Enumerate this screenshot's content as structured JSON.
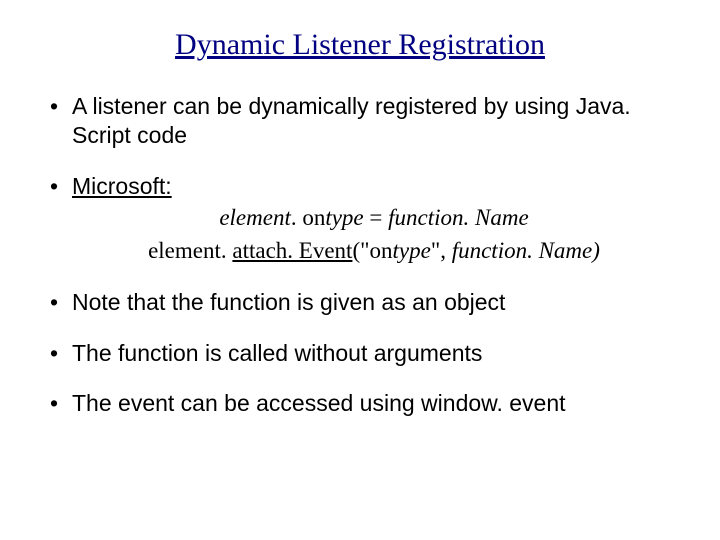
{
  "title": "Dynamic Listener Registration",
  "bullets": {
    "b1": "A listener can be dynamically registered by using Java. Script code",
    "b2": "Microsoft:",
    "b3": "Note that the function is given as an object",
    "b4": "The function is called without arguments",
    "b5": "The event can be accessed using window. event"
  },
  "code": {
    "el1": "element",
    "on1": ". on",
    "type1": "type",
    "eq": " = ",
    "fn1": "function. Name",
    "el2": "element. ",
    "attach": "attach. Event",
    "open_on": "(\"on",
    "type2": "type",
    "mid": "\", ",
    "fn2": "function. Name",
    "close": ")"
  }
}
